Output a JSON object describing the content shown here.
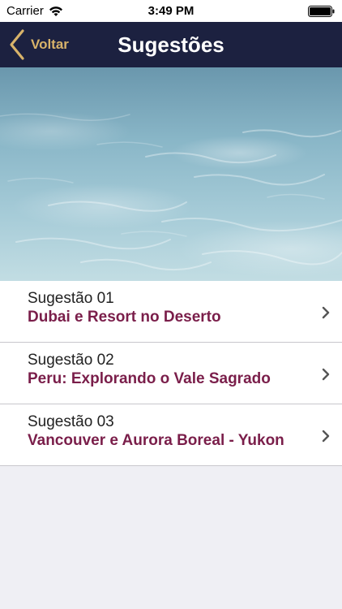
{
  "status_bar": {
    "carrier": "Carrier",
    "time": "3:49 PM",
    "wifi_icon": "wifi-icon",
    "battery_icon": "battery-icon"
  },
  "nav": {
    "back_label": "Voltar",
    "title": "Sugestões",
    "accent_color": "#d8b36a",
    "background_color": "#1c2140"
  },
  "suggestions": [
    {
      "label": "Sugestão 01",
      "title": "Dubai e Resort no Deserto"
    },
    {
      "label": "Sugestão 02",
      "title": "Peru: Explorando o Vale Sagrado"
    },
    {
      "label": "Sugestão 03",
      "title": "Vancouver e Aurora Boreal - Yukon"
    }
  ],
  "colors": {
    "item_title": "#7a1e4a",
    "background": "#efeff4"
  }
}
